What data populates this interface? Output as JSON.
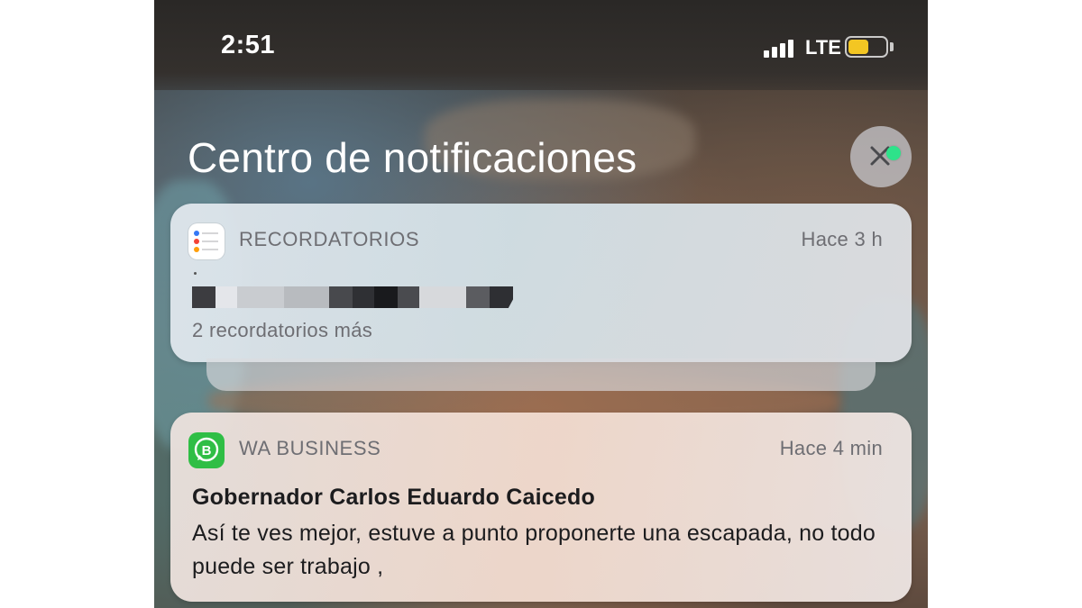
{
  "status_bar": {
    "time": "2:51",
    "network": "LTE",
    "battery_level": 0.55,
    "battery_color": "#f3c623",
    "signal_bars": 4
  },
  "notification_center": {
    "title": "Centro de notificaciones",
    "close_icon": "close-x-icon",
    "indicator_color": "#2ee28a"
  },
  "notifications": [
    {
      "app": "RECORDATORIOS",
      "icon": "reminders-icon",
      "time": "Hace 3 h",
      "redacted": true,
      "more": "2 recordatorios más"
    },
    {
      "app": "WA BUSINESS",
      "icon": "whatsapp-business-icon",
      "time": "Hace 4 min",
      "sender": "Gobernador Carlos Eduardo Caicedo",
      "message": "Así te ves mejor, estuve a punto proponerte una escapada, no todo puede ser trabajo ,"
    }
  ],
  "colors": {
    "whatsapp_green": "#2fbe45",
    "secondary_text": "#6e6e73",
    "primary_text": "#1c1c1e"
  }
}
